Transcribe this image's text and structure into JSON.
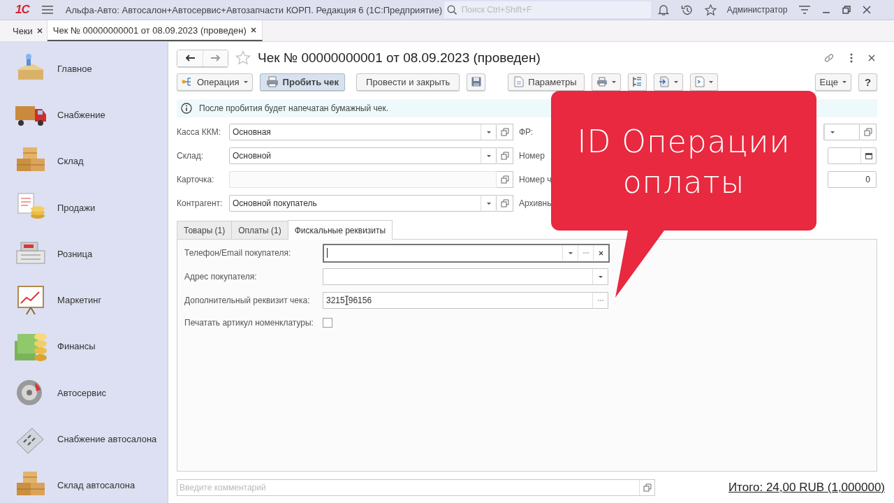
{
  "app_bar": {
    "logo": "1С",
    "title": "Альфа-Авто: Автосалон+Автосервис+Автозапчасти КОРП. Редакция 6  (1С:Предприятие)",
    "search": {
      "placeholder": "Поиск Ctrl+Shift+F"
    },
    "user": "Администратор"
  },
  "open_tabs": [
    {
      "label": "Чеки",
      "selected": false
    },
    {
      "label": "Чек № 00000000001 от 08.09.2023 (проведен)",
      "selected": true
    }
  ],
  "sidebar": {
    "items": [
      {
        "label": "Главное",
        "kind": "home"
      },
      {
        "label": "Снабжение",
        "kind": "truck"
      },
      {
        "label": "Склад",
        "kind": "boxes"
      },
      {
        "label": "Продажи",
        "kind": "coins"
      },
      {
        "label": "Розница",
        "kind": "register"
      },
      {
        "label": "Маркетинг",
        "kind": "chart"
      },
      {
        "label": "Финансы",
        "kind": "money"
      },
      {
        "label": "Автосервис",
        "kind": "wheel"
      },
      {
        "label": "Снабжение автосалона",
        "kind": "calculator"
      },
      {
        "label": "Склад автосалона",
        "kind": "boxes"
      }
    ]
  },
  "form": {
    "title": "Чек № 00000000001 от 08.09.2023 (проведен)",
    "toolbar": [
      {
        "kind": "menu",
        "label": "Операция"
      },
      {
        "kind": "primary",
        "label": "Пробить чек"
      },
      {
        "kind": "plain",
        "label": "Провести и закрыть"
      },
      {
        "kind": "save"
      },
      {
        "kind": "params",
        "label": "Параметры"
      },
      {
        "kind": "print"
      },
      {
        "kind": "structure"
      },
      {
        "kind": "exchange"
      },
      {
        "kind": "report"
      }
    ],
    "more_button": "Еще",
    "help_button": "?",
    "info": "После пробития будет напечатан бумажный чек.",
    "fields_left": [
      {
        "label": "Касса ККМ:",
        "value": "Основная",
        "dropdown": true
      },
      {
        "label": "Склад:",
        "value": "Основной",
        "dropdown": true
      },
      {
        "label": "Карточка:",
        "dropdown": false
      },
      {
        "label": "Контрагент:",
        "value": "Основной покупатель",
        "dropdown": true
      }
    ],
    "fields_right": [
      {
        "label": "ФР:",
        "kind": "select"
      },
      {
        "label": "Номер",
        "kind": "date"
      },
      {
        "label": "Номер ч",
        "kind": "number",
        "value": "0"
      },
      {
        "label": "Архивны",
        "kind": "none"
      }
    ],
    "tabs": [
      {
        "label": "Товары (1)",
        "selected": false
      },
      {
        "label": "Оплаты (1)",
        "selected": false
      },
      {
        "label": "Фискальные реквизиты",
        "selected": true
      }
    ],
    "fiscal_fields": [
      {
        "kind": "combo",
        "label": "Телефон/Email покупателя:",
        "focused": true
      },
      {
        "kind": "select",
        "label": "Адрес покупателя:",
        "focused": false
      },
      {
        "kind": "text",
        "label": "Дополнительный реквизит чека:",
        "value_before_cursor": "3215",
        "value_after_cursor": "96156",
        "focused": false
      },
      {
        "kind": "checkbox",
        "label": "Печатать артикул номенклатуры:",
        "checked": false
      }
    ],
    "comment": {
      "placeholder": "Введите комментарий"
    },
    "total": "Итого: 24,00 RUB (1,000000)"
  },
  "callout": {
    "lines": [
      "ID Операции",
      "оплаты"
    ]
  }
}
